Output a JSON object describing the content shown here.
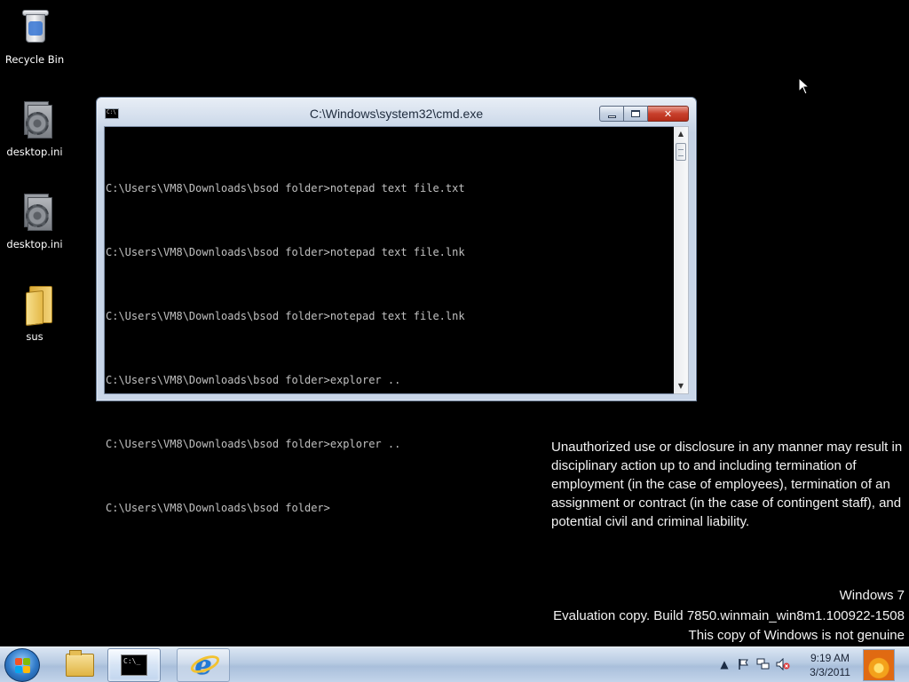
{
  "desktop": {
    "icons": [
      {
        "label": "Recycle Bin",
        "icon": "recycle-bin-icon"
      },
      {
        "label": "desktop.ini",
        "icon": "settings-file-icon"
      },
      {
        "label": "desktop.ini",
        "icon": "settings-file-icon"
      },
      {
        "label": "sus",
        "icon": "folder-icon"
      }
    ]
  },
  "cmd_window": {
    "title": "C:\\Windows\\system32\\cmd.exe",
    "lines": [
      "C:\\Users\\VM8\\Downloads\\bsod folder>notepad text file.txt",
      "C:\\Users\\VM8\\Downloads\\bsod folder>notepad text file.lnk",
      "C:\\Users\\VM8\\Downloads\\bsod folder>notepad text file.lnk",
      "C:\\Users\\VM8\\Downloads\\bsod folder>explorer ..",
      "C:\\Users\\VM8\\Downloads\\bsod folder>explorer ..",
      "C:\\Users\\VM8\\Downloads\\bsod folder>"
    ],
    "min_glyph": "",
    "max_glyph": "",
    "close_glyph": "✕"
  },
  "disclaimer": "Unauthorized use or disclosure in any manner may result in disciplinary action up to and including termination of employment (in the case of employees), termination of an assignment or contract (in the case of contingent staff), and potential civil and criminal liability.",
  "watermark": {
    "line1": "Windows 7",
    "line2": "Evaluation copy. Build 7850.winmain_win8m1.100922-1508",
    "line3": "This copy of Windows is not genuine"
  },
  "taskbar": {
    "pinned": [
      {
        "name": "windows-explorer",
        "icon": "folder-icon"
      },
      {
        "name": "command-prompt",
        "icon": "cmd-icon",
        "active": true
      },
      {
        "name": "internet-explorer",
        "icon": "ie-icon"
      }
    ],
    "tray_icons": [
      "show-hidden-icons-icon",
      "action-center-flag-icon",
      "network-icon",
      "volume-muted-icon"
    ],
    "clock_time": "9:19 AM",
    "clock_date": "3/3/2011"
  },
  "colors": {
    "desktop_bg": "#000000",
    "console_text": "#c0c0c0",
    "close_button": "#c8402c"
  }
}
